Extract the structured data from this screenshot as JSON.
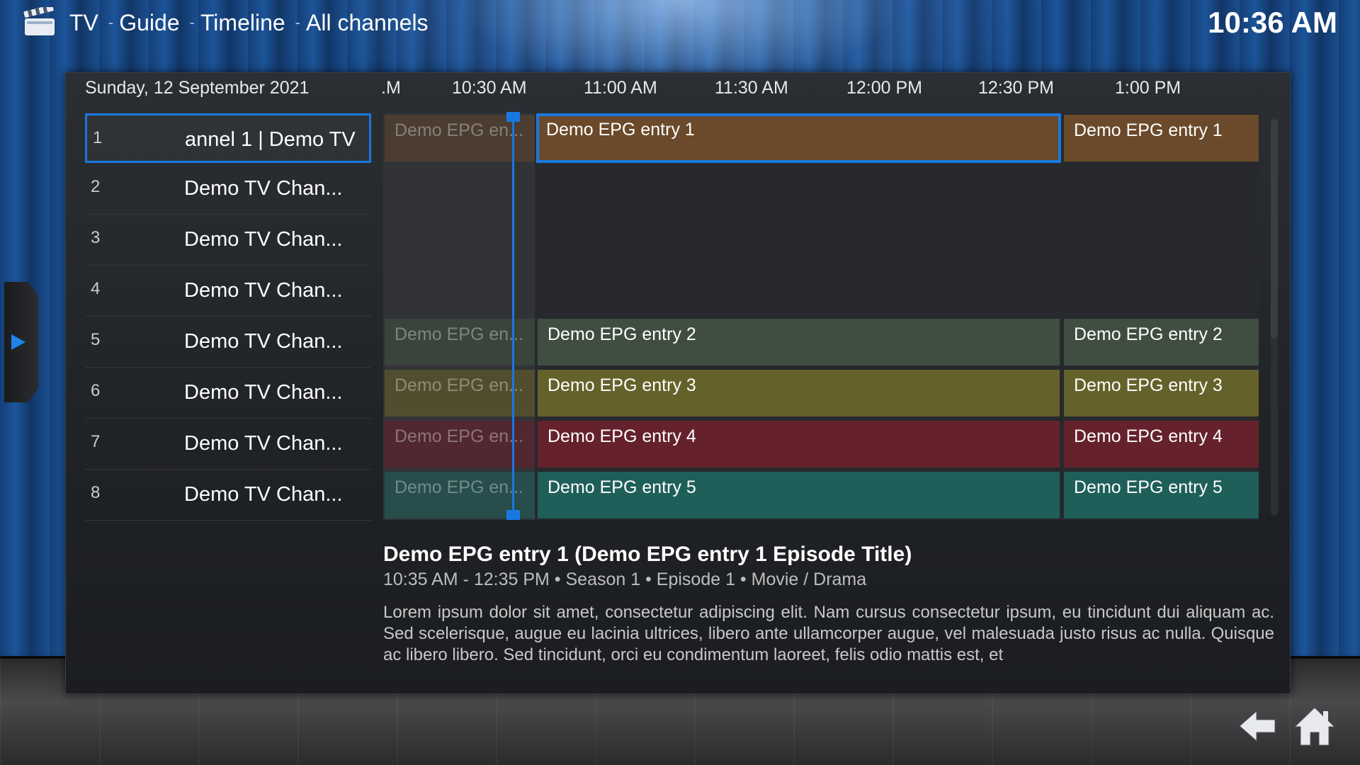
{
  "header": {
    "breadcrumbs": [
      "TV",
      "Guide",
      "Timeline",
      "All channels"
    ],
    "separator": "-",
    "clock": "10:36 AM"
  },
  "guide": {
    "date": "Sunday, 12 September 2021",
    "time_labels": [
      ".M",
      "10:30 AM",
      "11:00 AM",
      "11:30 AM",
      "12:00 PM",
      "12:30 PM",
      "1:00 PM"
    ],
    "channels": [
      {
        "number": "1",
        "name": "annel 1 | Demo TV"
      },
      {
        "number": "2",
        "name": "Demo TV Chan..."
      },
      {
        "number": "3",
        "name": "Demo TV Chan..."
      },
      {
        "number": "4",
        "name": "Demo TV Chan..."
      },
      {
        "number": "5",
        "name": "Demo TV Chan..."
      },
      {
        "number": "6",
        "name": "Demo TV Chan..."
      },
      {
        "number": "7",
        "name": "Demo TV Chan..."
      },
      {
        "number": "8",
        "name": "Demo TV Chan..."
      }
    ],
    "programs": {
      "row1": {
        "past": "Demo EPG en...",
        "current": "Demo EPG entry 1",
        "next": "Demo EPG entry 1",
        "color": "#6a4a2a"
      },
      "row5": {
        "past": "Demo EPG en...",
        "current": "Demo EPG entry 2",
        "next": "Demo EPG entry 2",
        "color": "#3f4e40"
      },
      "row6": {
        "past": "Demo EPG en...",
        "current": "Demo EPG entry 3",
        "next": "Demo EPG entry 3",
        "color": "#65612a"
      },
      "row7": {
        "past": "Demo EPG en...",
        "current": "Demo EPG entry 4",
        "next": "Demo EPG entry 4",
        "color": "#65222c"
      },
      "row8": {
        "past": "Demo EPG en...",
        "current": "Demo EPG entry 5",
        "next": "Demo EPG entry 5",
        "color": "#1f5f5a"
      }
    }
  },
  "info": {
    "title": "Demo EPG entry 1 (Demo EPG entry 1 Episode Title)",
    "meta": "10:35 AM - 12:35 PM • Season 1 • Episode 1 • Movie / Drama",
    "description": "Lorem ipsum dolor sit amet, consectetur adipiscing elit. Nam cursus consectetur ipsum, eu tincidunt dui aliquam ac. Sed scelerisque, augue eu lacinia ultrices, libero ante ullamcorper augue, vel malesuada justo risus ac nulla. Quisque ac libero libero. Sed tincidunt, orci eu condimentum laoreet, felis odio mattis est, et"
  },
  "icons": {
    "app": "clapperboard-icon",
    "side": "play-arrow-icon",
    "back": "back-arrow-icon",
    "home": "home-icon"
  },
  "colors": {
    "accent": "#1978e0"
  }
}
